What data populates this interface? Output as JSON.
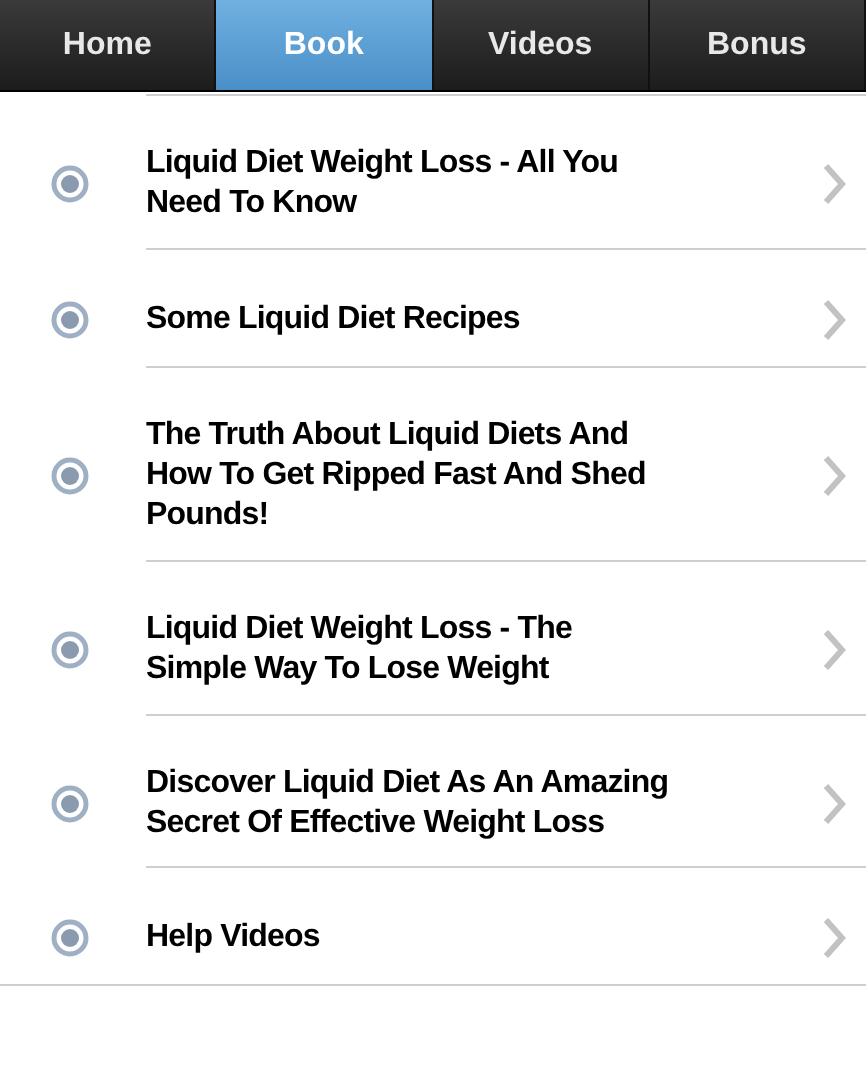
{
  "tabs": [
    {
      "label": "Home",
      "selected": false
    },
    {
      "label": "Book",
      "selected": true
    },
    {
      "label": "Videos",
      "selected": false
    },
    {
      "label": "Bonus",
      "selected": false
    }
  ],
  "items": [
    {
      "title": "Liquid Diet Weight Loss - All You Need To Know"
    },
    {
      "title": "Some Liquid Diet Recipes"
    },
    {
      "title": "The Truth About Liquid Diets And How To Get Ripped Fast And Shed Pounds!"
    },
    {
      "title": "Liquid Diet Weight Loss - The Simple Way To Lose Weight"
    },
    {
      "title": "Discover Liquid Diet As An Amazing Secret Of Effective Weight Loss"
    },
    {
      "title": "Help Videos"
    }
  ]
}
